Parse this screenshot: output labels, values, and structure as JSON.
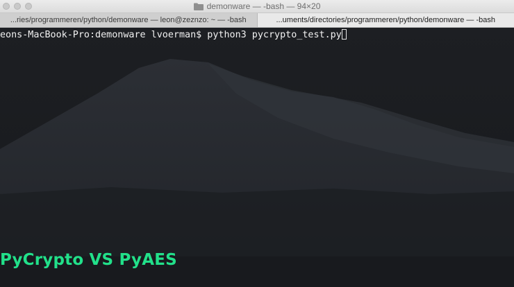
{
  "window": {
    "title": "demonware — -bash — 94×20",
    "folder_icon": "folder-icon"
  },
  "tabs": [
    {
      "label": "...ries/programmeren/python/demonware — leon@zeznzo: ~ — -bash",
      "active": false
    },
    {
      "label": "...uments/directories/programmeren/python/demonware — -bash",
      "active": true
    }
  ],
  "terminal": {
    "prompt": "eons-MacBook-Pro:demonware lvoerman$ ",
    "command": "python3 pycrypto_test.py"
  },
  "overlay": {
    "caption": "PyCrypto VS PyAES",
    "caption_color": "#22e08a"
  }
}
